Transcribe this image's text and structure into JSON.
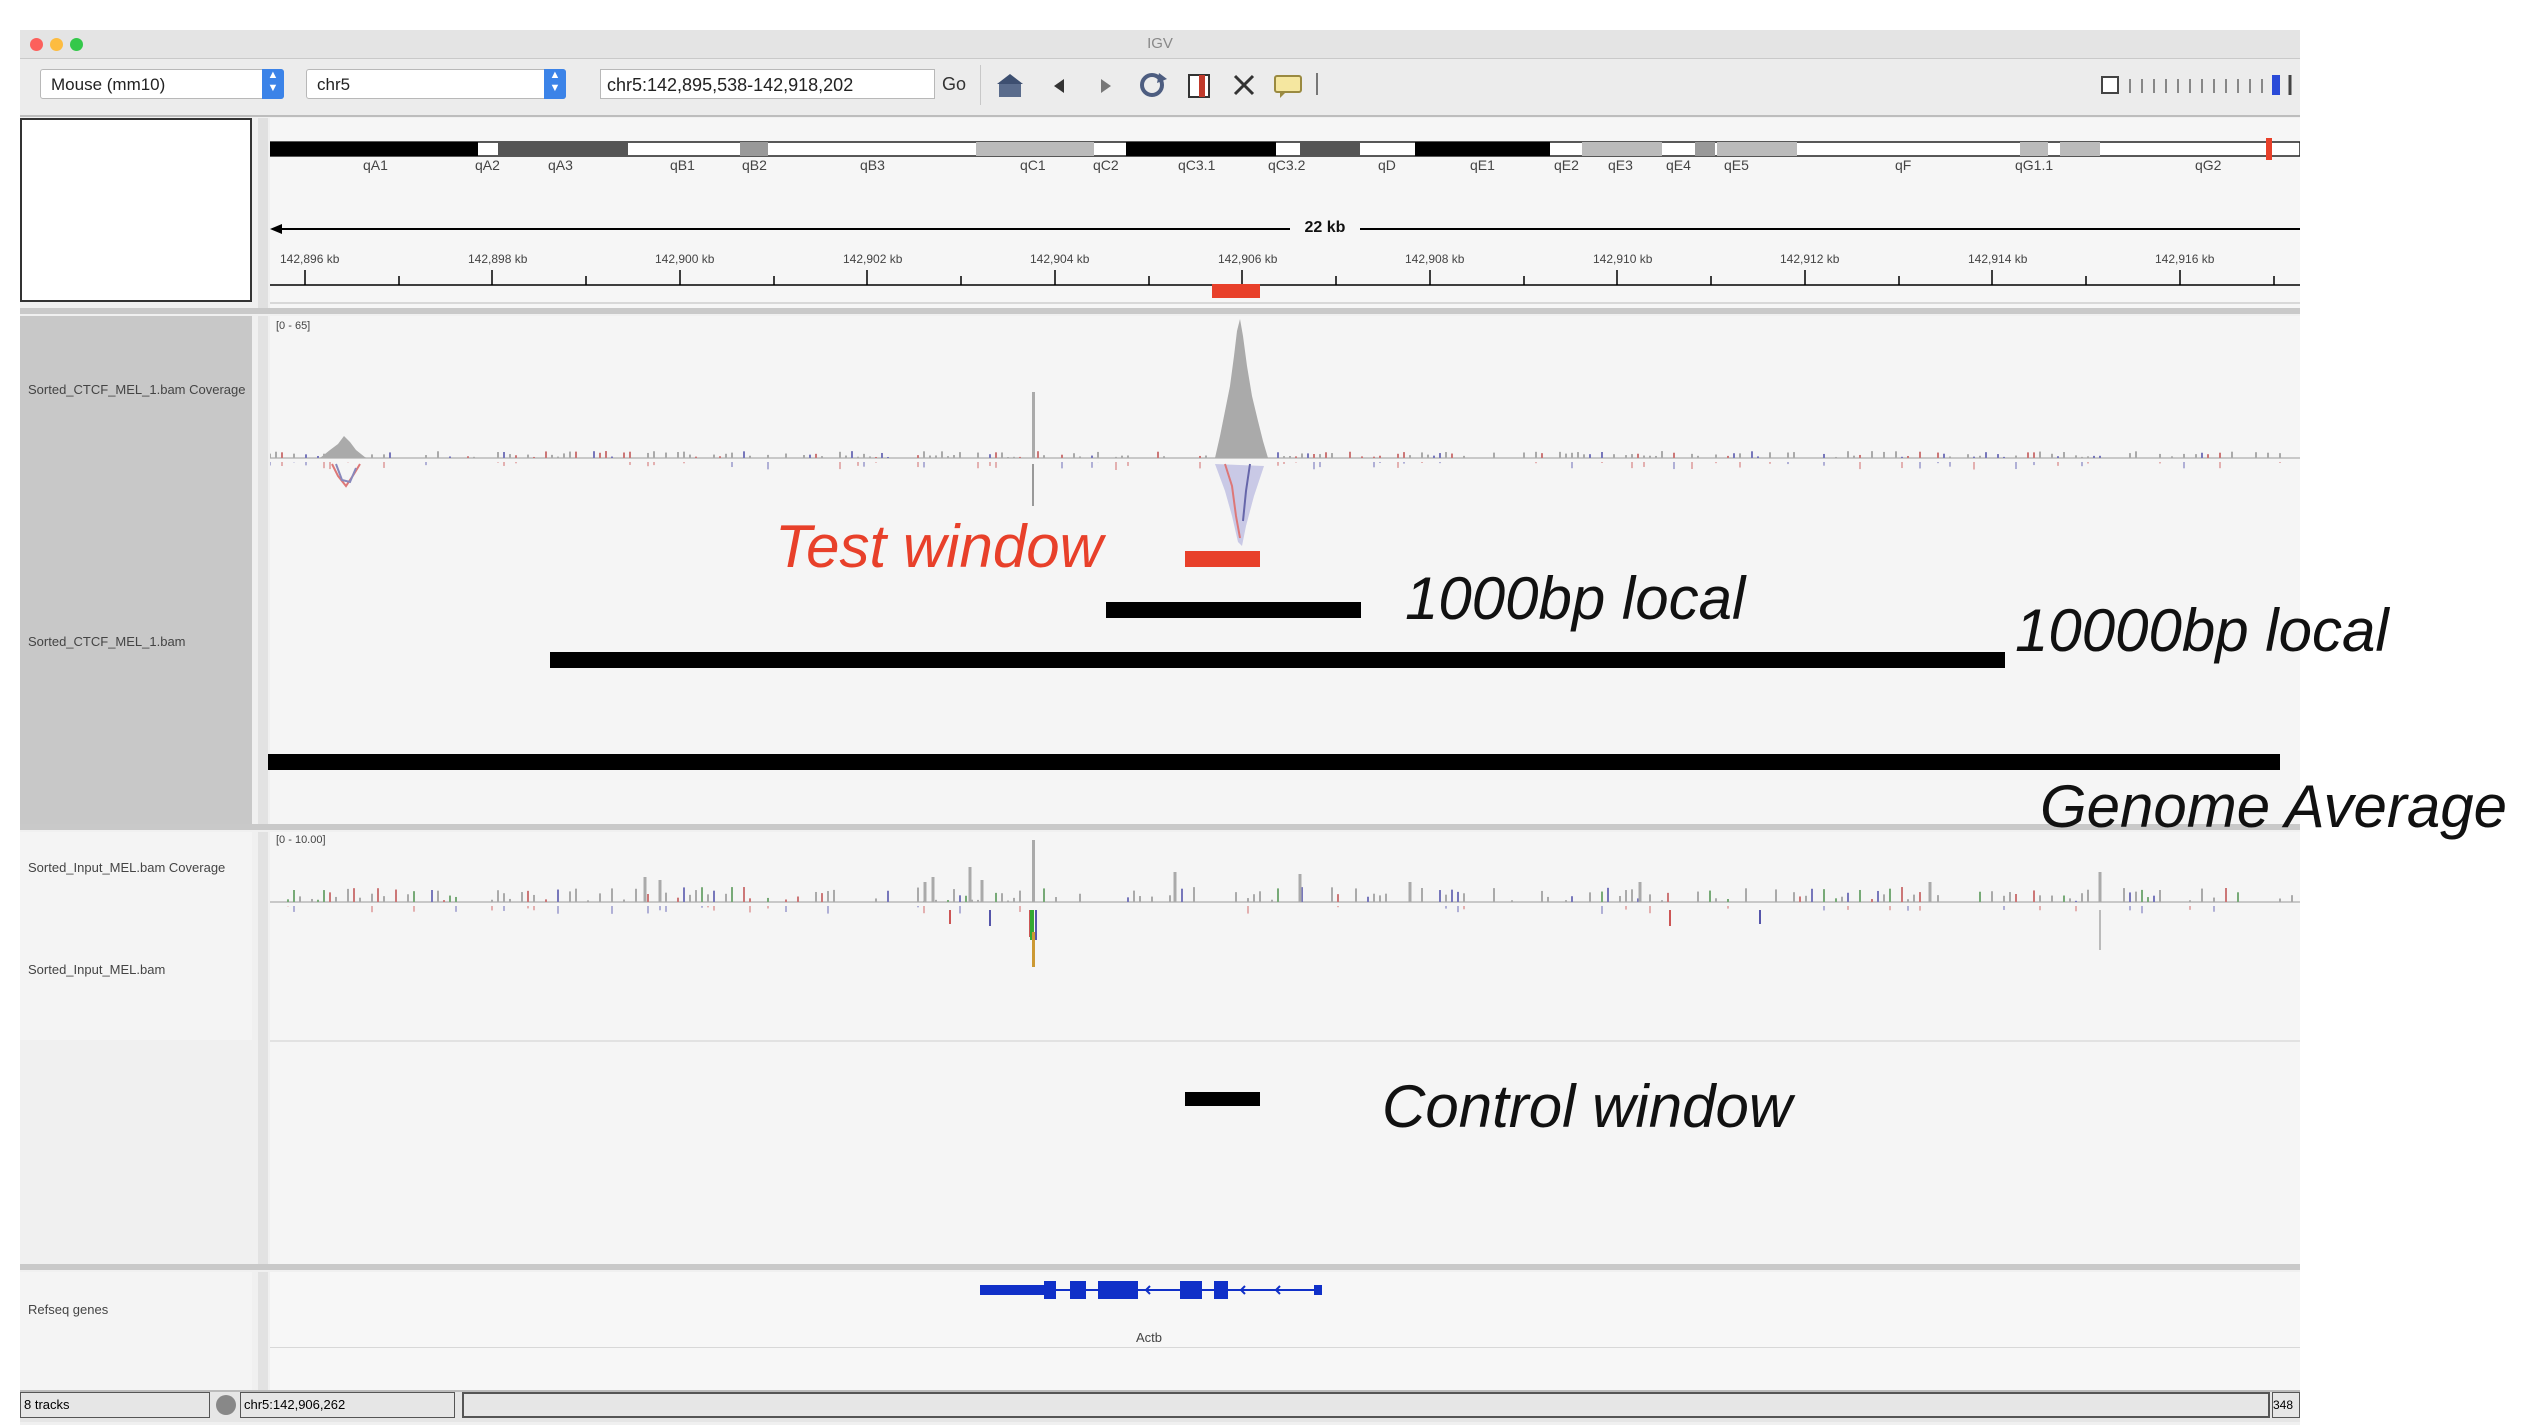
{
  "window": {
    "title": "IGV"
  },
  "toolbar": {
    "genome": "Mouse (mm10)",
    "chromosome": "chr5",
    "locus": "chr5:142,895,538-142,918,202",
    "go_label": "Go"
  },
  "ideogram": {
    "bands": [
      "qA1",
      "qA2",
      "qA3",
      "qB1",
      "qB2",
      "qB3",
      "qC1",
      "qC2",
      "qC3.1",
      "qC3.2",
      "qD",
      "qE1",
      "qE2",
      "qE3",
      "qE4",
      "qE5",
      "qF",
      "qG1.1",
      "qG2"
    ]
  },
  "ruler": {
    "span_label": "22 kb",
    "ticks": [
      "142,896 kb",
      "142,898 kb",
      "142,900 kb",
      "142,902 kb",
      "142,904 kb",
      "142,906 kb",
      "142,908 kb",
      "142,910 kb",
      "142,912 kb",
      "142,914 kb",
      "142,916 kb"
    ]
  },
  "tracks": {
    "ctcf_coverage_name": "Sorted_CTCF_MEL_1.bam Coverage",
    "ctcf_coverage_range": "[0 - 65]",
    "ctcf_bam_name": "Sorted_CTCF_MEL_1.bam",
    "input_coverage_name": "Sorted_Input_MEL.bam Coverage",
    "input_coverage_range": "[0 - 10.00]",
    "input_bam_name": "Sorted_Input_MEL.bam",
    "refseq_name": "Refseq genes",
    "gene_name": "Actb"
  },
  "annotations": {
    "test_window": "Test  window",
    "local_1000": "1000bp  local",
    "local_10000": "10000bp  local",
    "genome_average": "Genome  Average",
    "control_window": "Control  window"
  },
  "status": {
    "track_count": "8 tracks",
    "position": "chr5:142,906,262",
    "memory": "348"
  },
  "colors": {
    "test_window": "#e8402a",
    "annotation_bar": "#000000",
    "gene": "#1030c8",
    "coverage": "#b5b5b5",
    "track_label_bg": "#c8c8c8"
  }
}
